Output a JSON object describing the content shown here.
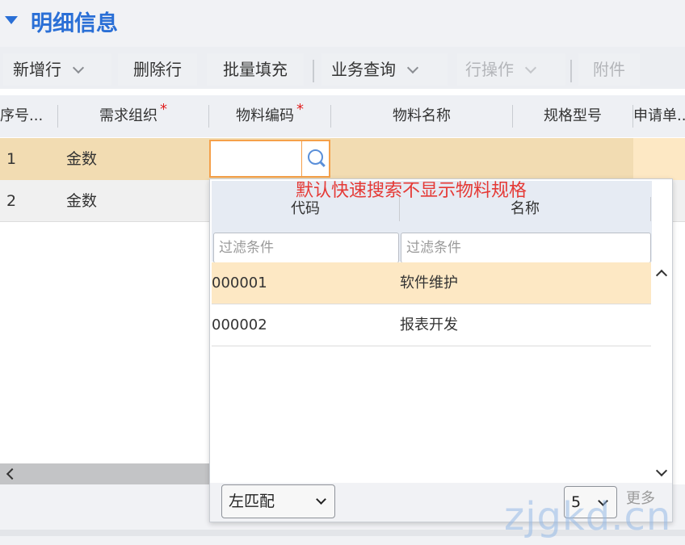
{
  "section": {
    "title": "明细信息"
  },
  "toolbar": {
    "add_row": "新增行",
    "delete_row": "删除行",
    "batch_fill": "批量填充",
    "business_query": "业务查询",
    "row_ops": "行操作",
    "attachment": "附件"
  },
  "grid": {
    "columns": [
      "序号...",
      "需求组织",
      "物料编码",
      "物料名称",
      "规格型号",
      "申请单..."
    ],
    "rows": [
      {
        "index": "1",
        "org": "金数"
      },
      {
        "index": "2",
        "org": "金数"
      }
    ]
  },
  "popup": {
    "note": "默认快速搜索不显示物料规格",
    "columns": [
      "代码",
      "名称"
    ],
    "filter_placeholder": "过滤条件",
    "rows": [
      {
        "code": "000001",
        "name": "软件维护"
      },
      {
        "code": "000002",
        "name": "报表开发"
      }
    ],
    "match_mode": "左匹配",
    "page_size": "5",
    "more": "更多"
  },
  "watermark": "zjgkd.cn",
  "colors": {
    "accent": "#2a6fd6",
    "selected_row": "#f2dcb2",
    "focus_border": "#f5a04a",
    "required": "#e02020",
    "note": "#e53935"
  }
}
